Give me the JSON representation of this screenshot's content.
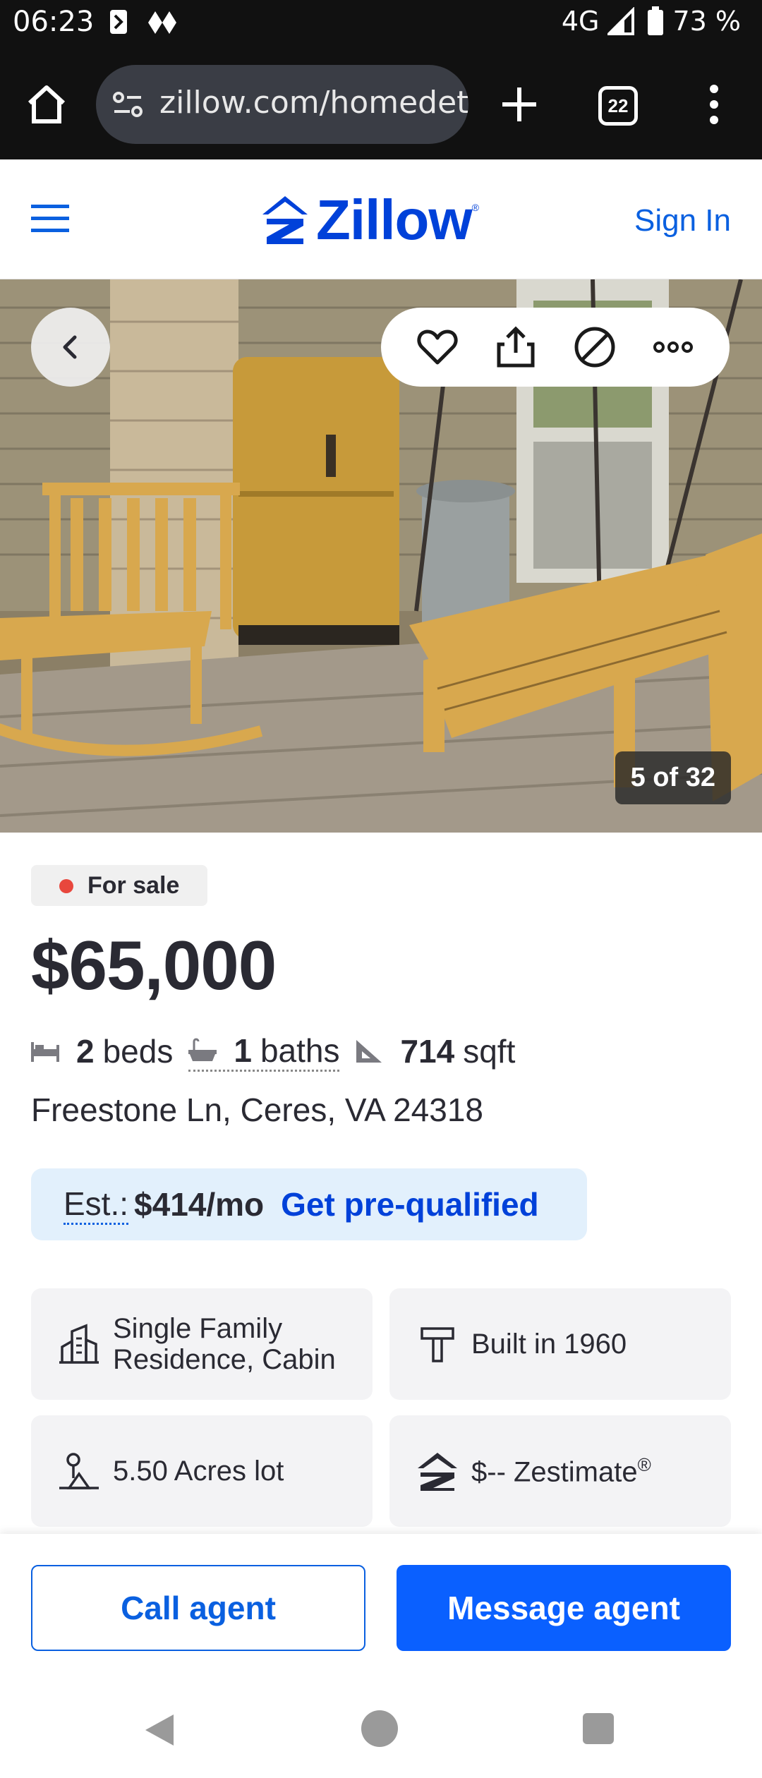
{
  "status_bar": {
    "time": "06:23",
    "network": "4G",
    "battery": "73 %"
  },
  "browser": {
    "url": "zillow.com/homedetails",
    "tab_count": "22"
  },
  "header": {
    "logo_text": "Zillow",
    "sign_in": "Sign In"
  },
  "photo": {
    "counter": "5 of 32"
  },
  "listing": {
    "status": "For sale",
    "price": "$65,000",
    "beds_num": "2",
    "beds_label": "beds",
    "baths_num": "1",
    "baths_label": "baths",
    "sqft_num": "714",
    "sqft_label": "sqft",
    "address": "Freestone Ln, Ceres, VA 24318"
  },
  "estimate": {
    "label": "Est.:",
    "value": "$414/mo",
    "link": "Get pre-qualified"
  },
  "tiles": {
    "type_line1": "Single Family",
    "type_line2": "Residence, Cabin",
    "built": "Built in 1960",
    "lot": "5.50 Acres lot",
    "zestimate": "$-- Zestimate",
    "zestimate_mark": "®"
  },
  "cta": {
    "call": "Call agent",
    "message": "Message agent"
  },
  "colors": {
    "brand_blue": "#0041d9",
    "button_blue": "#0a60ff",
    "for_sale_dot": "#e8473d"
  }
}
